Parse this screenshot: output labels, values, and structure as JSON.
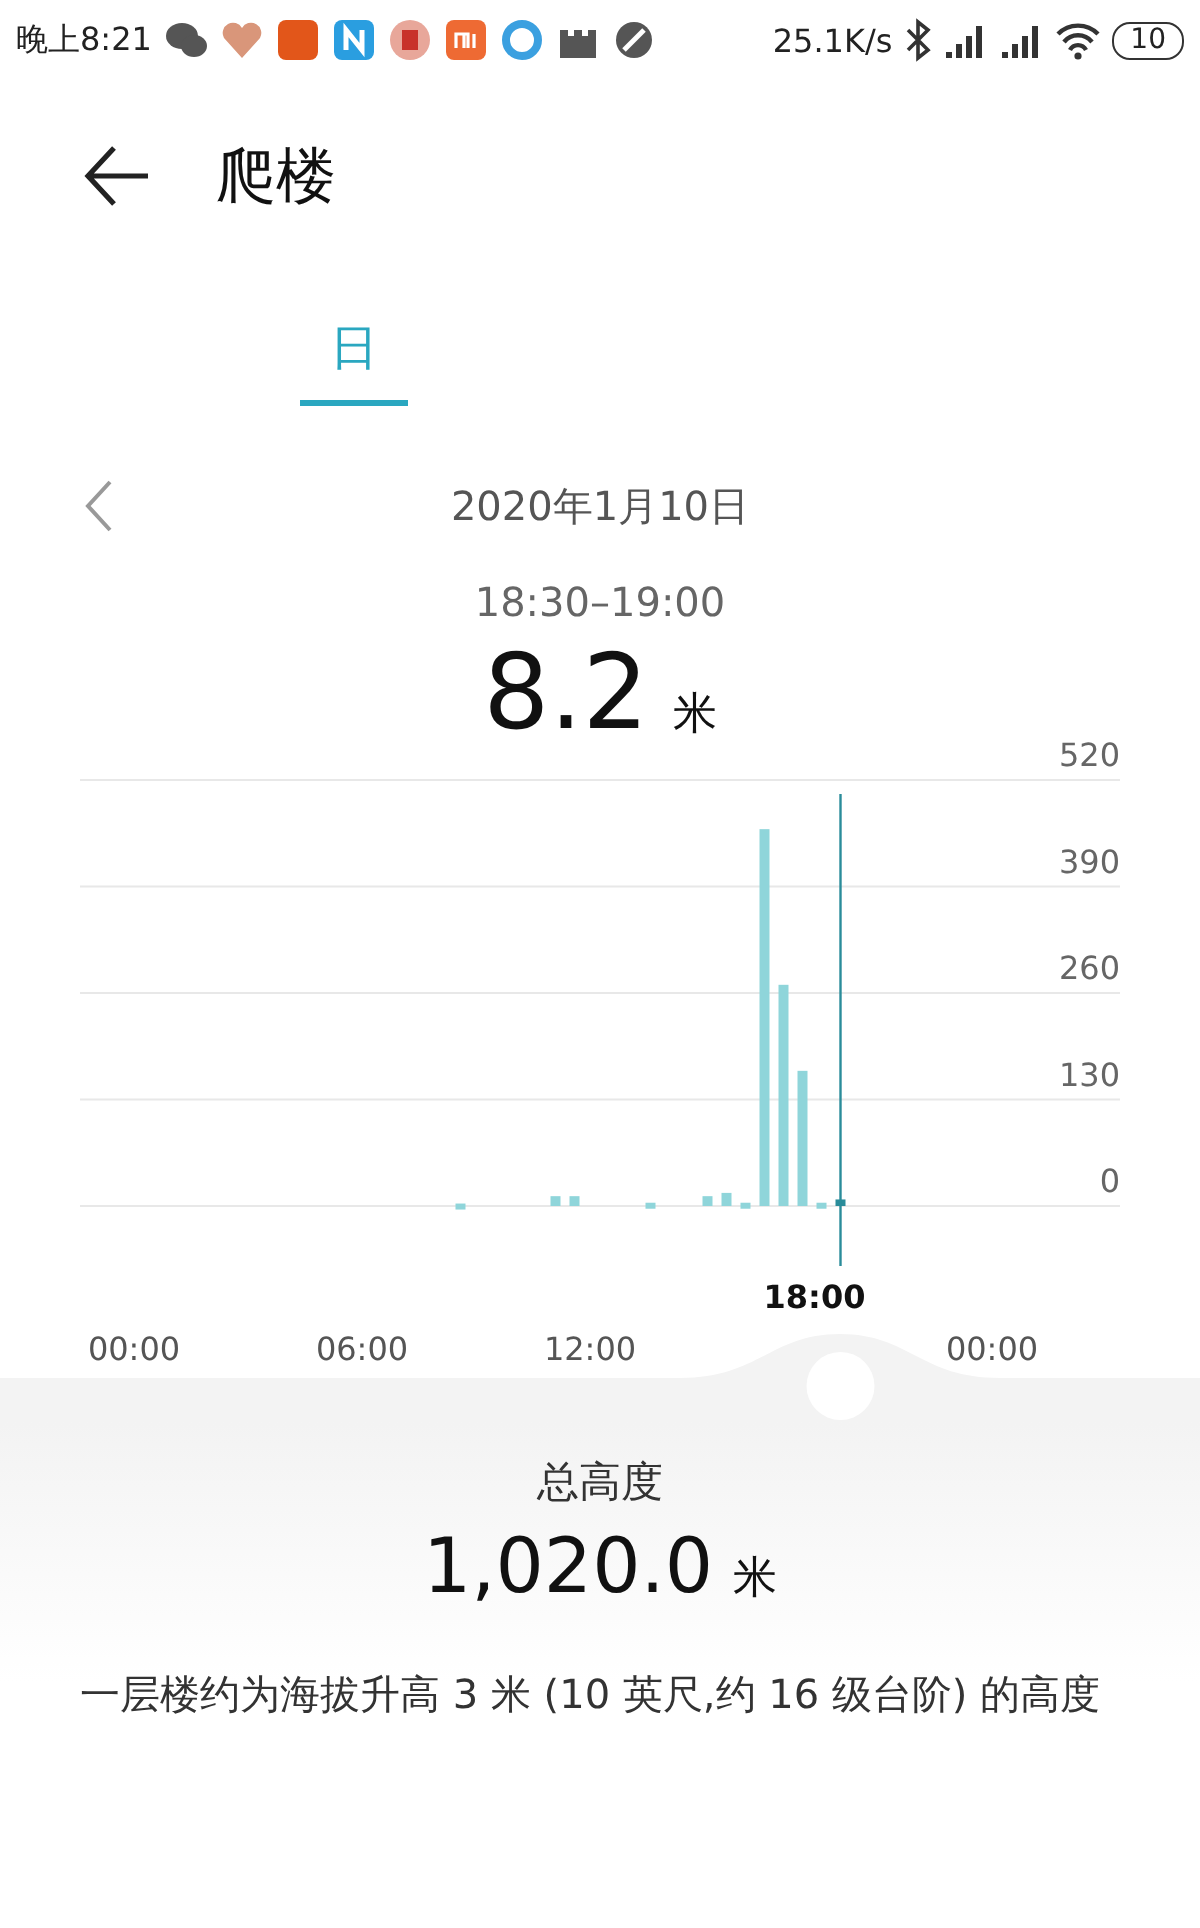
{
  "status_bar": {
    "time": "晚上8:21",
    "net_speed": "25.1K/s",
    "battery": "10"
  },
  "header": {
    "title": "爬楼"
  },
  "tabs": [
    {
      "label": "日",
      "selected": true
    }
  ],
  "date": "2020年1月10日",
  "period": "18:30–19:00",
  "reading": {
    "value": "8.2",
    "unit": "米"
  },
  "chart_data": {
    "type": "bar",
    "xlim": [
      0,
      24
    ],
    "ylim": [
      0,
      520
    ],
    "yticks": [
      0,
      130,
      260,
      390,
      520
    ],
    "xticks": [
      {
        "value": 0,
        "label": "00:00"
      },
      {
        "value": 6,
        "label": "06:00"
      },
      {
        "value": 12,
        "label": "12:00"
      },
      {
        "value": 24,
        "label": "00:00"
      }
    ],
    "grid": true,
    "x": [
      8.75,
      11.25,
      11.75,
      13.75,
      15.25,
      15.75,
      16.25,
      16.75,
      17.25,
      17.75,
      18.25,
      18.75
    ],
    "values": [
      3,
      12,
      12,
      4,
      12,
      16,
      4,
      460,
      270,
      165,
      4,
      8
    ],
    "ref_lines": [
      {
        "axis": "x",
        "value": 18.75
      }
    ],
    "annotations": [
      "18:00"
    ]
  },
  "total": {
    "label": "总高度",
    "value": "1,020.0",
    "unit": "米"
  },
  "note": "一层楼约为海拔升高 3 米 (10 英尺,约 16 级台阶) 的高度"
}
